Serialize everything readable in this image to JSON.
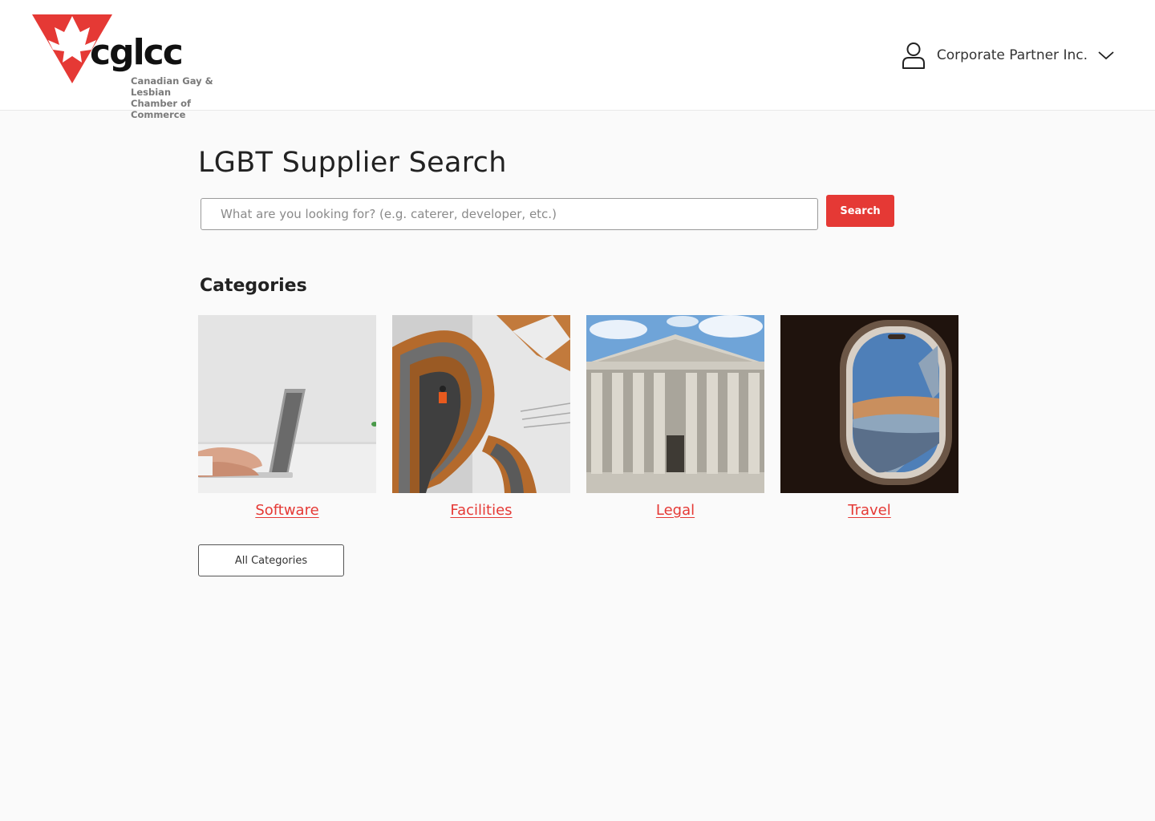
{
  "header": {
    "logo": {
      "wordmark": "cglcc",
      "subtitle_line1": "Canadian Gay & Lesbian",
      "subtitle_line2": "Chamber of Commerce",
      "icon": "maple-leaf-triangle-icon",
      "brand_color": "#e53935"
    },
    "user_menu": {
      "icon": "user-icon",
      "name": "Corporate Partner Inc.",
      "chevron": "chevron-down-icon"
    }
  },
  "main": {
    "title": "LGBT Supplier Search",
    "search": {
      "placeholder": "What are you looking for? (e.g. caterer, developer, etc.)",
      "value": "",
      "button_label": "Search"
    },
    "categories_heading": "Categories",
    "categories": [
      {
        "label": "Software",
        "image": "laptop-typing"
      },
      {
        "label": "Facilities",
        "image": "spiral-staircase"
      },
      {
        "label": "Legal",
        "image": "courthouse-columns"
      },
      {
        "label": "Travel",
        "image": "airplane-window"
      }
    ],
    "all_categories_label": "All Categories"
  },
  "colors": {
    "accent": "#e53935",
    "background": "#fafafa",
    "header_background": "#ffffff"
  }
}
